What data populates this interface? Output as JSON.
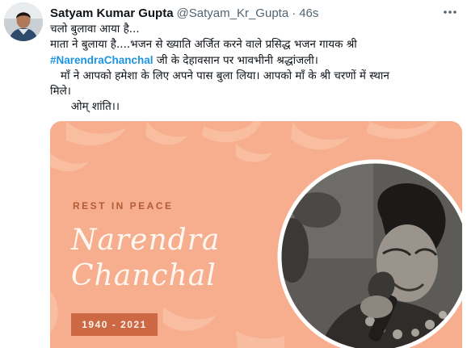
{
  "tweet": {
    "author_name": "Satyam Kumar Gupta",
    "author_handle": "@Satyam_Kr_Gupta",
    "separator": "·",
    "time": "46s",
    "lines": [
      "चलो बुलावा आया है...",
      "माता ने बुलाया है....भजन से ख्याति अर्जित करने वाले प्रसिद्ध भजन गायक श्री",
      "जी के देहावसान पर भावभीनी श्रद्धांजली।",
      "   माँ ने आपको हमेशा के लिए अपने पास बुला लिया। आपको माँ के श्री चरणों में स्थान",
      "मिले।",
      "      ओम् शांति।।"
    ],
    "hashtag": "#NarendraChanchal"
  },
  "card": {
    "kicker": "REST IN PEACE",
    "first_name": "Narendra",
    "last_name": "Chanchal",
    "years": "1940 - 2021"
  },
  "icons": {
    "more": "more-horizontal-icon",
    "avatar": "user-avatar",
    "photo": "singer-portrait"
  },
  "colors": {
    "card_bg": "#f6ae8e",
    "years_bg": "#cd6845",
    "hashtag": "#1b95e0",
    "circle_border": "#ffffff"
  }
}
